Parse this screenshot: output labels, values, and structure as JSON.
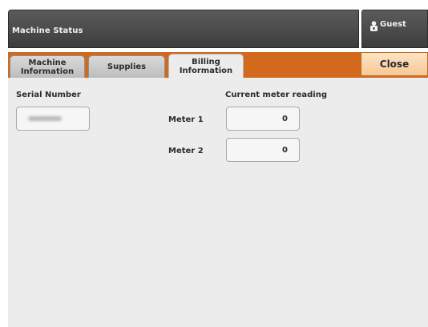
{
  "header": {
    "title": "Machine Status",
    "user_label": "Guest",
    "user_icon": "user-lock-icon"
  },
  "tabs": [
    {
      "label": "Machine Information",
      "line1": "Machine",
      "line2": "Information",
      "active": false
    },
    {
      "label": "Supplies",
      "active": false
    },
    {
      "label": "Billing Information",
      "line1": "Billing",
      "line2": "Information",
      "active": true
    }
  ],
  "close_label": "Close",
  "billing": {
    "serial_label": "Serial Number",
    "serial_value_redacted": true,
    "meter_heading": "Current meter reading",
    "meters": [
      {
        "label": "Meter 1",
        "value": "0"
      },
      {
        "label": "Meter 2",
        "value": "0"
      }
    ]
  },
  "colors": {
    "accent_orange": "#d2691c",
    "close_button": "#f6c896",
    "header_bg": "#4a4a4a",
    "content_bg": "#ececec"
  }
}
